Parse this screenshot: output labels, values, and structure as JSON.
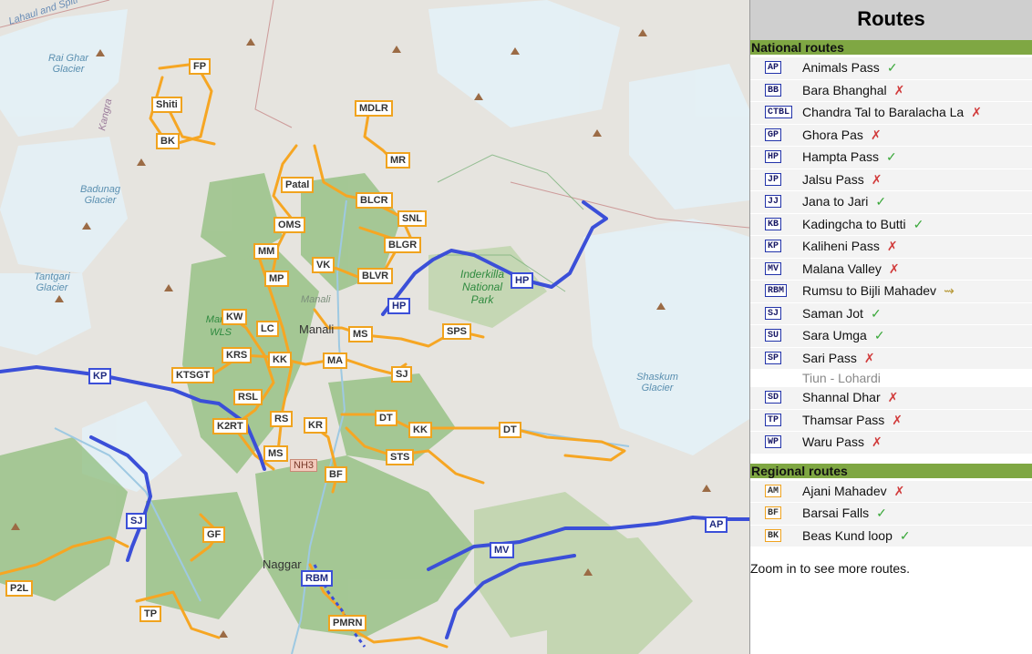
{
  "panel": {
    "title": "Routes",
    "national_header": "National routes",
    "regional_header": "Regional routes",
    "zoom_note": "Zoom in to see more routes."
  },
  "national_routes": [
    {
      "code": "AP",
      "name": "Animals Pass",
      "status": "✓",
      "kind": "ok"
    },
    {
      "code": "BB",
      "name": "Bara Bhanghal",
      "status": "✗",
      "kind": "no"
    },
    {
      "code": "CTBL",
      "name": "Chandra Tal to Baralacha La",
      "status": "✗",
      "kind": "no"
    },
    {
      "code": "GP",
      "name": "Ghora Pas",
      "status": "✗",
      "kind": "no"
    },
    {
      "code": "HP",
      "name": "Hampta Pass",
      "status": "✓",
      "kind": "ok"
    },
    {
      "code": "JP",
      "name": "Jalsu Pass",
      "status": "✗",
      "kind": "no"
    },
    {
      "code": "JJ",
      "name": "Jana to Jari",
      "status": "✓",
      "kind": "ok"
    },
    {
      "code": "KB",
      "name": "Kadingcha to Butti",
      "status": "✓",
      "kind": "ok"
    },
    {
      "code": "KP",
      "name": "Kaliheni Pass",
      "status": "✗",
      "kind": "no"
    },
    {
      "code": "MV",
      "name": "Malana Valley",
      "status": "✗",
      "kind": "no"
    },
    {
      "code": "RBM",
      "name": "Rumsu to Bijli Mahadev",
      "status": "⇝",
      "kind": "mixed"
    },
    {
      "code": "SJ",
      "name": "Saman Jot",
      "status": "✓",
      "kind": "ok"
    },
    {
      "code": "SU",
      "name": "Sara Umga",
      "status": "✓",
      "kind": "ok"
    },
    {
      "code": "SP",
      "name": "Sari Pass",
      "status": "✗",
      "kind": "no",
      "note": "Tiun - Lohardi"
    },
    {
      "code": "SD",
      "name": "Shannal Dhar",
      "status": "✗",
      "kind": "no"
    },
    {
      "code": "TP",
      "name": "Thamsar Pass",
      "status": "✗",
      "kind": "no"
    },
    {
      "code": "WP",
      "name": "Waru Pass",
      "status": "✗",
      "kind": "no"
    }
  ],
  "regional_routes": [
    {
      "code": "AM",
      "name": "Ajani Mahadev",
      "status": "✗",
      "kind": "no"
    },
    {
      "code": "BF",
      "name": "Barsai Falls",
      "status": "✓",
      "kind": "ok"
    },
    {
      "code": "BK",
      "name": "Beas Kund loop",
      "status": "✓",
      "kind": "ok"
    }
  ],
  "map": {
    "place_labels": {
      "lahaul": "Lahaul and Spiti",
      "rai_ghar": "Rai Ghar Glacier",
      "kangra": "Kangra",
      "badunag": "Badunag Glacier",
      "tantgari": "Tantgari Glacier",
      "shaskum": "Shaskum Glacier",
      "manali_wls": "Manali WLS",
      "manali_small": "Manali",
      "inderkilla": "Inderkilla National Park",
      "manali": "Manali",
      "naggar": "Naggar",
      "nh3": "NH3"
    },
    "national_markers": [
      "KP",
      "HP",
      "HP",
      "SJ",
      "MV",
      "AP",
      "RBM"
    ],
    "regional_markers": [
      "FP",
      "Shiti",
      "BK",
      "MDLR",
      "MR",
      "Patal",
      "BLCR",
      "SNL",
      "OMS",
      "BLGR",
      "MM",
      "VK",
      "BLVR",
      "MP",
      "KW",
      "LC",
      "SPS",
      "MS",
      "KRS",
      "KK",
      "MA",
      "KTSGT",
      "SJ",
      "RSL",
      "DT",
      "KK",
      "DT",
      "RS",
      "KR",
      "K2RT",
      "MS",
      "STS",
      "BF",
      "GF",
      "P2L",
      "TP",
      "PMRN"
    ],
    "colors": {
      "national_route": "#3b4fd8",
      "regional_route": "#f6a623",
      "forest": "#8dbb7a",
      "glacier": "#dfeef6",
      "river": "#9ec9e2"
    }
  }
}
